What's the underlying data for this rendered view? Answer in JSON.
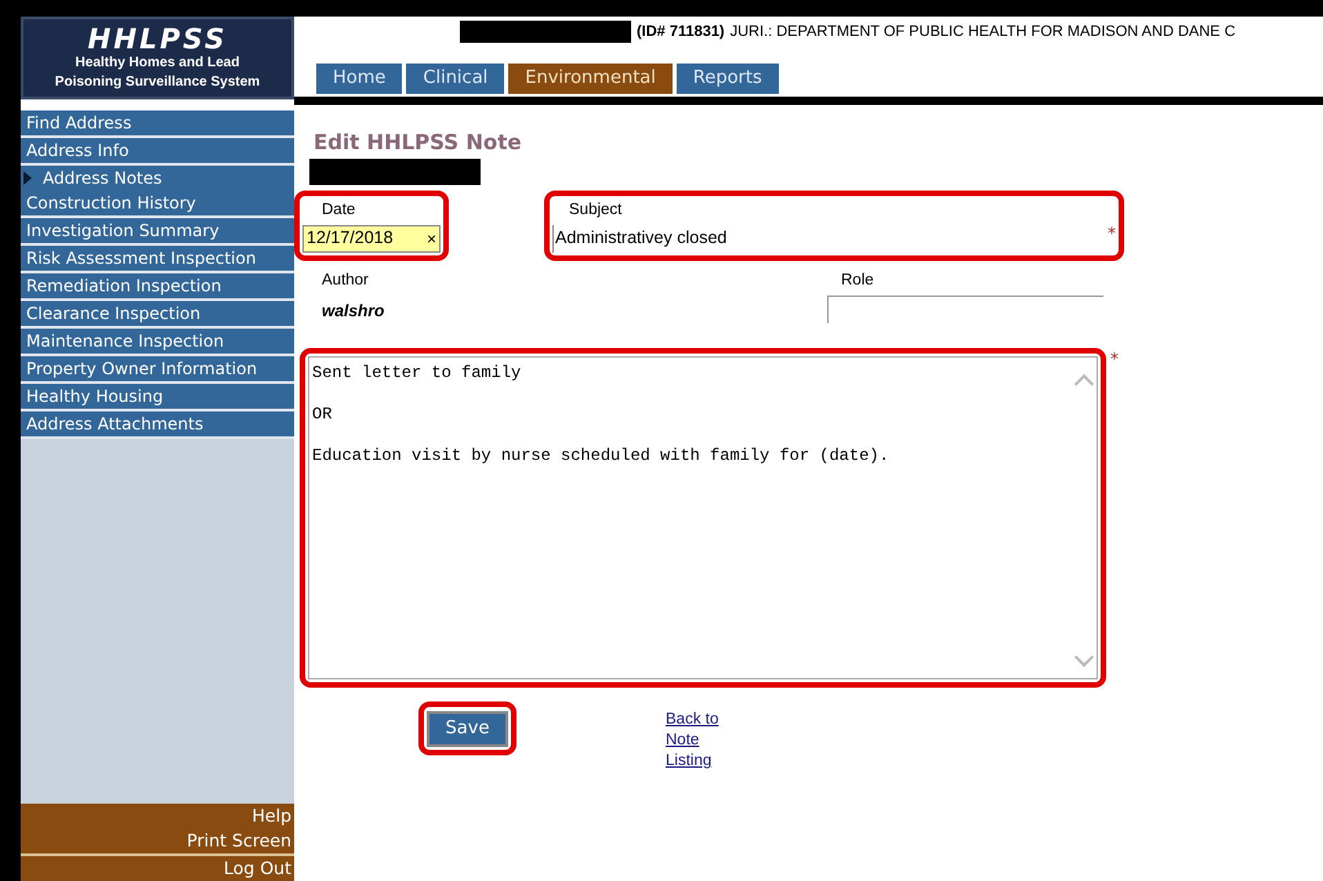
{
  "logo": {
    "title": "HHLPSS",
    "subtitle": "Healthy Homes and Lead Poisoning Surveillance System"
  },
  "header": {
    "record": "(ID# 711831)",
    "jurisdiction": "JURI.: DEPARTMENT OF PUBLIC HEALTH FOR MADISON AND DANE C"
  },
  "tabs": [
    {
      "label": "Home",
      "selected": false
    },
    {
      "label": "Clinical",
      "selected": false
    },
    {
      "label": "Environmental",
      "selected": true
    },
    {
      "label": "Reports",
      "selected": false
    }
  ],
  "sidebar": {
    "items": [
      {
        "label": "Find Address",
        "selected": false
      },
      {
        "label": "Address Info",
        "selected": false
      },
      {
        "label": "Address Notes",
        "selected": true
      },
      {
        "label": "Construction History",
        "selected": false
      },
      {
        "label": "Investigation Summary",
        "selected": false
      },
      {
        "label": "Risk Assessment Inspection",
        "selected": false
      },
      {
        "label": "Remediation Inspection",
        "selected": false
      },
      {
        "label": "Clearance Inspection",
        "selected": false
      },
      {
        "label": "Maintenance Inspection",
        "selected": false
      },
      {
        "label": "Property Owner Information",
        "selected": false
      },
      {
        "label": "Healthy Housing",
        "selected": false
      },
      {
        "label": "Address Attachments",
        "selected": false
      }
    ],
    "footer": [
      "Help",
      "Print Screen",
      "Log Out"
    ]
  },
  "form": {
    "title": "Edit HHLPSS Note",
    "date": {
      "label": "Date",
      "value": "12/17/2018",
      "clear": "×",
      "highlighted": true
    },
    "subject": {
      "label": "Subject",
      "value": "Administrativey closed",
      "required_mark": "*",
      "highlighted": true
    },
    "author": {
      "label": "Author",
      "value": "walshro"
    },
    "role": {
      "label": "Role"
    },
    "note": {
      "value": "Sent letter to family\n\nOR\n\nEducation visit by nurse scheduled with family for (date).",
      "required_mark": "*",
      "highlighted": true
    },
    "save": {
      "label": "Save",
      "highlighted": true
    },
    "back_link": "Back to Note Listing"
  }
}
